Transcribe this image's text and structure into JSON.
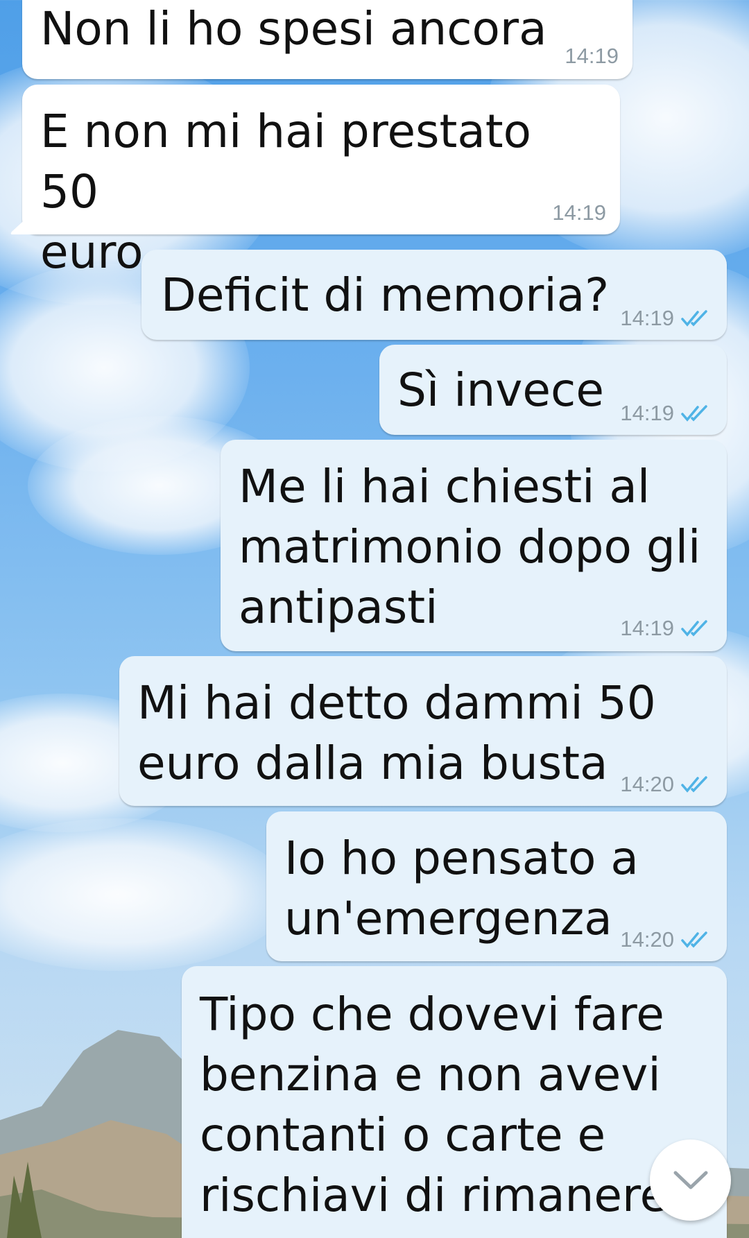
{
  "messages": [
    {
      "direction": "incoming",
      "text": "Non li ho spesi ancora",
      "time": "14:19"
    },
    {
      "direction": "incoming",
      "text": "E non mi hai prestato 50\neuro",
      "time": "14:19"
    },
    {
      "direction": "outgoing",
      "text": "Deficit di memoria?",
      "time": "14:19",
      "status": "read"
    },
    {
      "direction": "outgoing",
      "text": "Sì invece",
      "time": "14:19",
      "status": "read"
    },
    {
      "direction": "outgoing",
      "text": "Me li hai chiesti al\nmatrimonio dopo gli\nantipasti",
      "time": "14:19",
      "status": "read"
    },
    {
      "direction": "outgoing",
      "text": "Mi hai detto dammi 50\neuro dalla mia busta",
      "time": "14:20",
      "status": "read"
    },
    {
      "direction": "outgoing",
      "text": "Io ho pensato a\nun'emergenza",
      "time": "14:20",
      "status": "read"
    },
    {
      "direction": "outgoing",
      "text": "Tipo che dovevi fare\nbenzina e non avevi\ncontanti o carte e\nrischiavi di rimanere",
      "time": "",
      "status": ""
    }
  ],
  "scroll_button": {
    "icon": "chevron-down-icon"
  },
  "colors": {
    "incoming_bubble": "#ffffff",
    "outgoing_bubble": "#e6f2fb",
    "read_tick": "#4fb3e6",
    "timestamp": "#8d9aa3"
  }
}
